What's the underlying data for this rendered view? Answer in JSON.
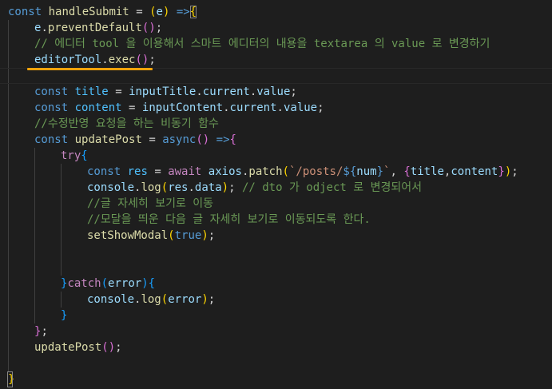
{
  "code": {
    "l1": {
      "kw": "const",
      "name": "handleSubmit",
      "eq": "=",
      "p1": "(",
      "arg": "e",
      "p2": ")",
      "arrow": "=>",
      "brace": "{"
    },
    "l2": {
      "obj": "e",
      "dot": ".",
      "fn": "preventDefault",
      "p": "()",
      "end": ";"
    },
    "l3": {
      "comment": "// 에디터 tool 을 이용해서 스마트 에디터의 내용을 textarea 의 value 로 변경하기"
    },
    "l4": {
      "obj": "editorTool",
      "dot": ".",
      "fn": "exec",
      "p": "()",
      "end": ";"
    },
    "l6": {
      "kw": "const",
      "name": "title",
      "eq": "=",
      "obj": "inputTitle",
      "d1": ".",
      "p1": "current",
      "d2": ".",
      "p2": "value",
      "end": ";"
    },
    "l7": {
      "kw": "const",
      "name": "content",
      "eq": "=",
      "obj": "inputContent",
      "d1": ".",
      "p1": "current",
      "d2": ".",
      "p2": "value",
      "end": ";"
    },
    "l8": {
      "comment": "//수정반영 요청을 하는 비동기 함수"
    },
    "l9": {
      "kw": "const",
      "name": "updatePost",
      "eq": "=",
      "async": "async",
      "p": "()",
      "arrow": "=>",
      "brace": "{"
    },
    "l10": {
      "kw": "try",
      "brace": "{"
    },
    "l11": {
      "kw": "const",
      "name": "res",
      "eq": "=",
      "await": "await",
      "obj": "axios",
      "dot": ".",
      "fn": "patch",
      "p1": "(",
      "s1": "`/posts/",
      "tpl_open": "${",
      "tpl_var": "num",
      "tpl_close": "}",
      "s2": "`",
      "comma": ",",
      "b_open": "{",
      "v1": "title",
      "c2": ",",
      "v2": "content",
      "b_close": "}",
      "p2": ")",
      "end": ";"
    },
    "l12": {
      "obj": "console",
      "dot": ".",
      "fn": "log",
      "p1": "(",
      "arg": "res",
      "dot2": ".",
      "prop": "data",
      "p2": ")",
      "end": ";",
      "comment": "// dto 가 odject 로 변경되어서"
    },
    "l13": {
      "comment": "//글 자세히 보기로 이동"
    },
    "l14": {
      "comment": "//모달을 띄운 다음 글 자세히 보기로 이동되도록 한다."
    },
    "l15": {
      "fn": "setShowModal",
      "p1": "(",
      "arg": "true",
      "p2": ")",
      "end": ";"
    },
    "l18": {
      "brace": "}",
      "kw": "catch",
      "p1": "(",
      "arg": "error",
      "p2": ")",
      "brace2": "{"
    },
    "l19": {
      "obj": "console",
      "dot": ".",
      "fn": "log",
      "p1": "(",
      "arg": "error",
      "p2": ")",
      "end": ";"
    },
    "l20": {
      "brace": "}"
    },
    "l21": {
      "brace": "}",
      "end": ";"
    },
    "l22": {
      "fn": "updatePost",
      "p": "()",
      "end": ";"
    },
    "l24": {
      "brace": "}"
    }
  },
  "colors": {
    "background": "#1e1e1e",
    "keyword": "#569cd6",
    "control": "#c586c0",
    "variable": "#9cdcfe",
    "constant": "#4fc1ff",
    "function": "#dcdcaa",
    "string": "#ce9178",
    "comment": "#6a9955",
    "bracket_level1": "#ffd700",
    "bracket_level2": "#da70d6",
    "bracket_level3": "#179fff",
    "annotation_underline": "#f0a30a"
  }
}
